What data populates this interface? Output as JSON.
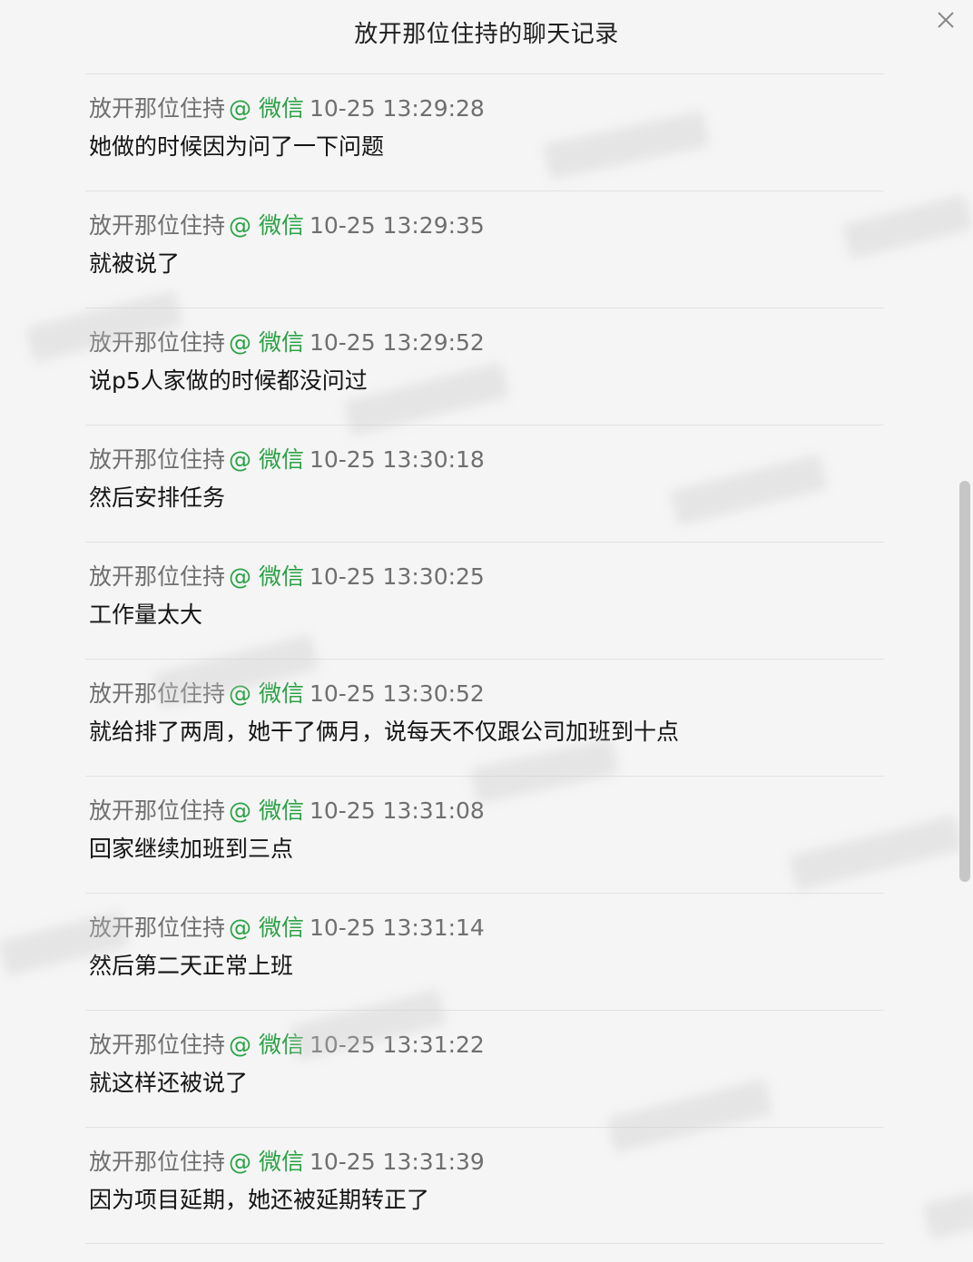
{
  "window": {
    "title": "放开那位住持的聊天记录"
  },
  "messages": [
    {
      "sender": "放开那位住持",
      "platform": "@ 微信",
      "time": "10-25 13:29:28",
      "text": "她做的时候因为问了一下问题"
    },
    {
      "sender": "放开那位住持",
      "platform": "@ 微信",
      "time": "10-25 13:29:35",
      "text": "就被说了"
    },
    {
      "sender": "放开那位住持",
      "platform": "@ 微信",
      "time": "10-25 13:29:52",
      "text": "说p5人家做的时候都没问过"
    },
    {
      "sender": "放开那位住持",
      "platform": "@ 微信",
      "time": "10-25 13:30:18",
      "text": "然后安排任务"
    },
    {
      "sender": "放开那位住持",
      "platform": "@ 微信",
      "time": "10-25 13:30:25",
      "text": "工作量太大"
    },
    {
      "sender": "放开那位住持",
      "platform": "@ 微信",
      "time": "10-25 13:30:52",
      "text": "就给排了两周，她干了俩月，说每天不仅跟公司加班到十点"
    },
    {
      "sender": "放开那位住持",
      "platform": "@ 微信",
      "time": "10-25 13:31:08",
      "text": "回家继续加班到三点"
    },
    {
      "sender": "放开那位住持",
      "platform": "@ 微信",
      "time": "10-25 13:31:14",
      "text": "然后第二天正常上班"
    },
    {
      "sender": "放开那位住持",
      "platform": "@ 微信",
      "time": "10-25 13:31:22",
      "text": "就这样还被说了"
    },
    {
      "sender": "放开那位住持",
      "platform": "@ 微信",
      "time": "10-25 13:31:39",
      "text": "因为项目延期，她还被延期转正了"
    }
  ]
}
